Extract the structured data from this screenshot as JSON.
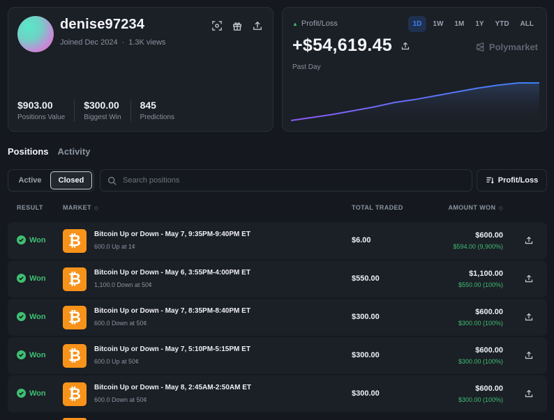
{
  "profile": {
    "username": "denise97234",
    "joined": "Joined Dec 2024",
    "views": "1.3K views",
    "stats": [
      {
        "value": "$903.00",
        "label": "Positions Value"
      },
      {
        "value": "$300.00",
        "label": "Biggest Win"
      },
      {
        "value": "845",
        "label": "Predictions"
      }
    ]
  },
  "pnl": {
    "title": "Profit/Loss",
    "amount": "+$54,619.45",
    "period_label": "Past Day",
    "brand": "Polymarket",
    "periods": [
      "1D",
      "1W",
      "1M",
      "1Y",
      "YTD",
      "ALL"
    ],
    "active_period": "1D",
    "colors": {
      "line_start": "#8b5cf6",
      "line_end": "#3b82f6",
      "positive": "#3fbf72"
    }
  },
  "chart_data": {
    "type": "area",
    "x": [
      0,
      1,
      2,
      3,
      4,
      5,
      6,
      7,
      8,
      9,
      10,
      11,
      12
    ],
    "y": [
      0,
      4,
      8,
      13,
      18,
      24,
      28,
      33,
      38,
      43,
      47,
      50,
      50
    ],
    "title": "",
    "xlabel": "",
    "ylabel": ""
  },
  "tabs": {
    "positions": "Positions",
    "activity": "Activity"
  },
  "filters": {
    "active": "Active",
    "closed": "Closed",
    "search_placeholder": "Search positions",
    "sort_label": "Profit/Loss"
  },
  "table": {
    "headers": {
      "result": "RESULT",
      "market": "MARKET",
      "total": "TOTAL TRADED",
      "amount": "AMOUNT WON"
    },
    "rows": [
      {
        "result": "Won",
        "title": "Bitcoin Up or Down - May 7, 9:35PM-9:40PM ET",
        "sub": "600.0 Up at 1¢",
        "total": "$6.00",
        "amount": "$600.00",
        "profit": "$594.00 (9,900%)"
      },
      {
        "result": "Won",
        "title": "Bitcoin Up or Down - May 6, 3:55PM-4:00PM ET",
        "sub": "1,100.0 Down at 50¢",
        "total": "$550.00",
        "amount": "$1,100.00",
        "profit": "$550.00 (100%)"
      },
      {
        "result": "Won",
        "title": "Bitcoin Up or Down - May 7, 8:35PM-8:40PM ET",
        "sub": "600.0 Down at 50¢",
        "total": "$300.00",
        "amount": "$600.00",
        "profit": "$300.00 (100%)"
      },
      {
        "result": "Won",
        "title": "Bitcoin Up or Down - May 7, 5:10PM-5:15PM ET",
        "sub": "600.0 Up at 50¢",
        "total": "$300.00",
        "amount": "$600.00",
        "profit": "$300.00 (100%)"
      },
      {
        "result": "Won",
        "title": "Bitcoin Up or Down - May 8, 2:45AM-2:50AM ET",
        "sub": "600.0 Down at 50¢",
        "total": "$300.00",
        "amount": "$600.00",
        "profit": "$300.00 (100%)"
      }
    ]
  }
}
